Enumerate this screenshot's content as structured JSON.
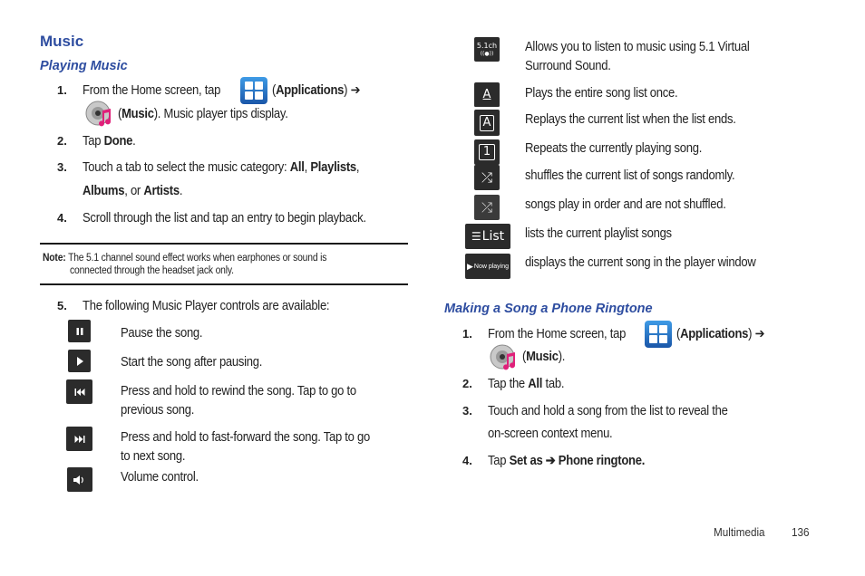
{
  "left": {
    "title": "Music",
    "subtitle": "Playing Music",
    "steps": {
      "s1": {
        "num": "1.",
        "a": "From the Home screen, tap",
        "b_open": "(",
        "b_apps": "Applications",
        "b_close": ") ➔",
        "c_open": "(",
        "c_music": "Music",
        "c_rest": "). Music player tips display."
      },
      "s2": {
        "num": "2.",
        "a": "Tap ",
        "b": "Done",
        "c": "."
      },
      "s3": {
        "num": "3.",
        "a": "Touch a tab to select the music category: ",
        "all": "All",
        "comma1": ", ",
        "playlists": "Playlists",
        "comma2": ",",
        "albums": "Albums",
        "or": ", or ",
        "artists": "Artists",
        "end": "."
      },
      "s4": {
        "num": "4.",
        "a": "Scroll through the list and tap an entry to begin playback."
      },
      "s5": {
        "num": "5.",
        "a": "The following Music Player controls are available:"
      }
    },
    "note": {
      "label": "Note:",
      "line1": "The 5.1 channel sound effect works when earphones or sound is",
      "line2": "connected through the headset jack only."
    },
    "controls": [
      {
        "icon": "pause-icon",
        "line1": "Pause the song.",
        "line2": ""
      },
      {
        "icon": "play-icon",
        "line1": "Start the song after pausing.",
        "line2": ""
      },
      {
        "icon": "rewind-icon",
        "line1": "Press and hold to rewind the song. Tap to go to",
        "line2": "previous song."
      },
      {
        "icon": "fast-forward-icon",
        "line1": "Press and hold to fast-forward  the song. Tap to go",
        "line2": "to next song."
      },
      {
        "icon": "volume-icon",
        "line1": "Volume control.",
        "line2": ""
      }
    ]
  },
  "right": {
    "controls": [
      {
        "icon": "surround-5-1-icon",
        "glyph": "5.1ch",
        "line1": "Allows you to listen to music using 5.1 Virtual",
        "line2": "Surround Sound."
      },
      {
        "icon": "play-once-icon",
        "glyph": "A",
        "line1": "Plays the entire song list once.",
        "line2": ""
      },
      {
        "icon": "repeat-all-icon",
        "glyph": "A",
        "line1": "Replays the current list when the list ends.",
        "line2": ""
      },
      {
        "icon": "repeat-one-icon",
        "glyph": "1",
        "line1": "Repeats the currently playing song.",
        "line2": ""
      },
      {
        "icon": "shuffle-on-icon",
        "glyph": "⤮",
        "line1": "shuffles the current list of songs randomly.",
        "line2": ""
      },
      {
        "icon": "shuffle-off-icon",
        "glyph": "⤮",
        "line1": "songs play in order and are not shuffled.",
        "line2": ""
      },
      {
        "icon": "list-icon",
        "glyph": "List",
        "line1": "lists the current playlist songs",
        "line2": ""
      },
      {
        "icon": "now-playing-icon",
        "glyph": "Now playing",
        "line1": "displays the current song in the player window",
        "line2": ""
      }
    ],
    "subtitle": "Making a Song a Phone Ringtone",
    "steps": {
      "s1": {
        "num": "1.",
        "a": "From the Home screen, tap",
        "b_open": "(",
        "b_apps": "Applications",
        "b_close": ") ➔",
        "c_open": "(",
        "c_music": "Music",
        "c_rest": ")."
      },
      "s2": {
        "num": "2.",
        "a": "Tap the ",
        "b": "All",
        "c": " tab."
      },
      "s3": {
        "num": "3.",
        "line1": "Touch and hold a song from the list to reveal the",
        "line2": "on-screen context menu."
      },
      "s4": {
        "num": "4.",
        "a": "Tap ",
        "b": "Set as ➔ Phone ringtone."
      }
    }
  },
  "footer": {
    "section": "Multimedia",
    "page": "136"
  },
  "colors": {
    "heading": "#2e4da0",
    "icon_bg": "#2b2b2b",
    "apps_top": "#3f9be6",
    "apps_bottom": "#1a56a8",
    "music_pink": "#e0207a"
  }
}
